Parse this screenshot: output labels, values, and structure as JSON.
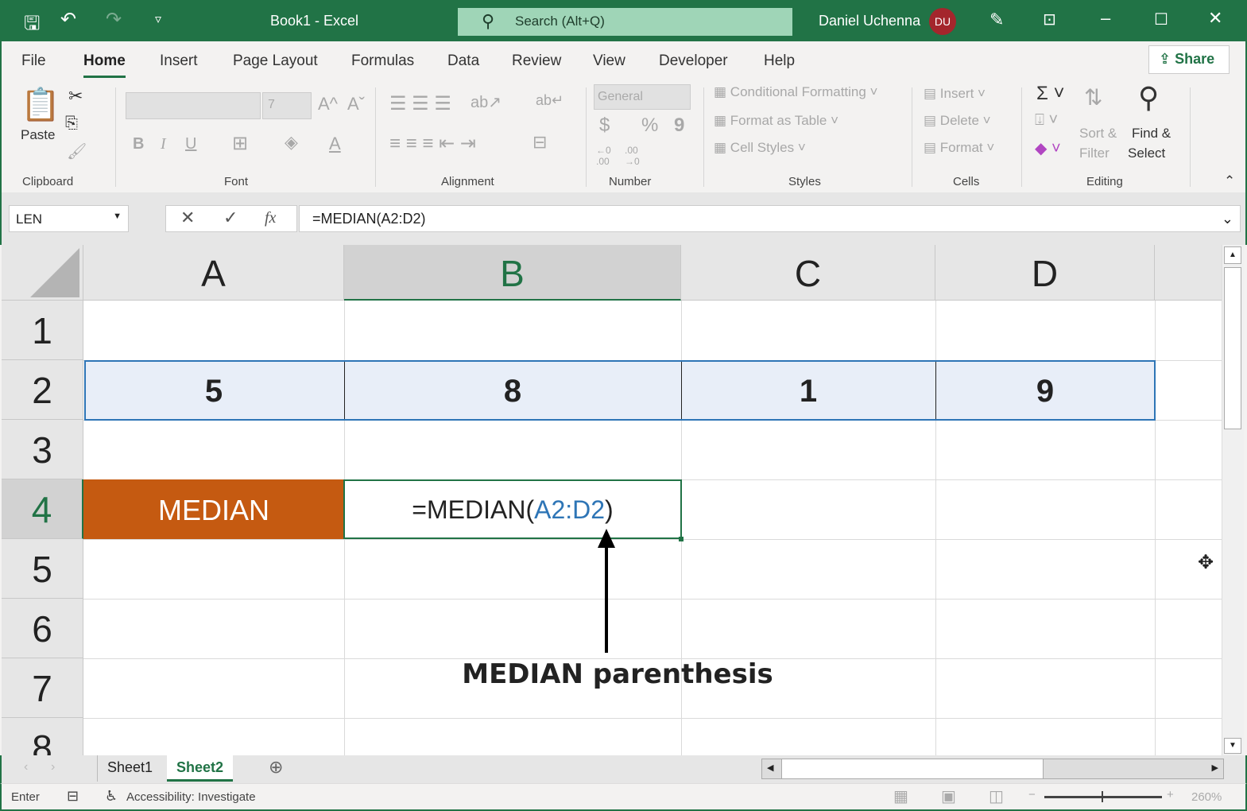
{
  "titlebar": {
    "doc_title": "Book1  -  Excel",
    "search_placeholder": "Search (Alt+Q)",
    "user_name": "Daniel Uchenna",
    "user_initials": "DU"
  },
  "menu": {
    "tabs": [
      "File",
      "Home",
      "Insert",
      "Page Layout",
      "Formulas",
      "Data",
      "Review",
      "View",
      "Developer",
      "Help"
    ],
    "active": "Home",
    "share": "Share"
  },
  "ribbon": {
    "clipboard": {
      "paste": "Paste",
      "label": "Clipboard"
    },
    "font": {
      "size": "7",
      "label": "Font",
      "bold": "B",
      "italic": "I",
      "underline": "U",
      "grow": "A^",
      "shrink": "Aˇ",
      "color": "A"
    },
    "alignment": {
      "label": "Alignment"
    },
    "number": {
      "format": "General",
      "currency": "$",
      "percent": "%",
      "comma": "9",
      "inc_decimal": "←0 .00",
      "dec_decimal": ".00 →0",
      "label": "Number"
    },
    "styles": {
      "conditional": "Conditional Formatting",
      "format_table": "Format as Table",
      "cell_styles": "Cell Styles",
      "label": "Styles"
    },
    "cells": {
      "insert": "Insert",
      "delete": "Delete",
      "format": "Format",
      "label": "Cells"
    },
    "editing": {
      "sort1": "Sort &",
      "sort2": "Filter",
      "find1": "Find &",
      "find2": "Select",
      "label": "Editing"
    }
  },
  "formula_bar": {
    "name_box": "LEN",
    "fx": "fx",
    "formula": "=MEDIAN(A2:D2)"
  },
  "grid": {
    "columns": [
      "A",
      "B",
      "C",
      "D"
    ],
    "rows": [
      "1",
      "2",
      "3",
      "4",
      "5",
      "6",
      "7",
      "8"
    ],
    "row2": [
      "5",
      "8",
      "1",
      "9"
    ],
    "a4": "MEDIAN",
    "b4_prefix": "=MEDIAN(",
    "b4_range": "A2:D2",
    "b4_suffix": ")"
  },
  "annotation": "MEDIAN parenthesis",
  "sheets": {
    "tabs": [
      "Sheet1",
      "Sheet2"
    ],
    "active": "Sheet2"
  },
  "status": {
    "mode": "Enter",
    "accessibility": "Accessibility: Investigate",
    "zoom": "260%"
  },
  "colors": {
    "excel_green": "#217346",
    "median_fill": "#c55a11",
    "range_blue": "#2e75b6",
    "selection_fill": "#e8eef8"
  }
}
